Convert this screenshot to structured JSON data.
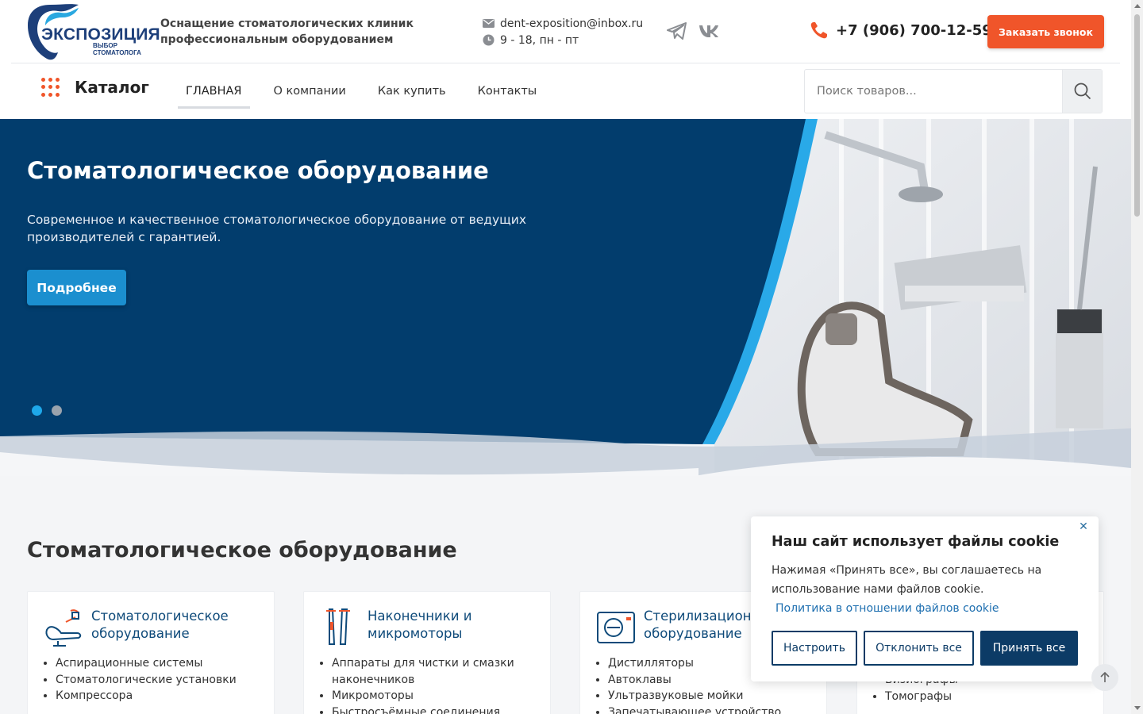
{
  "header": {
    "logo_text": "ЭКСПОЗИЦИЯ",
    "logo_sub": "ВЫБОР СТОМАТОЛОГА",
    "tagline": "Оснащение стоматологических клиник профессиональным оборудованием",
    "email": "dent-exposition@inbox.ru",
    "hours": "9 - 18, пн - пт",
    "phone": "+7 (906) 700-12-59",
    "callback_label": "Заказать звонок",
    "brand_color": "#1d3f7a",
    "accent_color": "#f0552a"
  },
  "nav": {
    "catalog_label": "Каталог",
    "items": [
      {
        "label": "ГЛАВНАЯ"
      },
      {
        "label": "О компании"
      },
      {
        "label": "Как купить"
      },
      {
        "label": "Контакты"
      }
    ],
    "search_placeholder": "Поиск товаров..."
  },
  "hero": {
    "title": "Стоматологическое оборудование",
    "text": "Современное и качественное стоматологическое оборудование от ведущих производителей с гарантией.",
    "button_label": "Подробнее",
    "slides_total": 2,
    "active_slide": 1,
    "bg_color": "#023d6d"
  },
  "section": {
    "title": "Стоматологическое оборудование",
    "cards": [
      {
        "title": "Стоматологическое оборудование",
        "icon": "dental-chair-icon",
        "items": [
          "Аспирационные системы",
          "Стоматологические установки",
          "Компрессора"
        ]
      },
      {
        "title": "Наконечники и микромоторы",
        "icon": "handpiece-icon",
        "items": [
          "Аппараты для чистки и смазки наконечников",
          "Микромоторы",
          "Быстросъёмные соединения"
        ]
      },
      {
        "title": "Стерилизационное оборудование",
        "icon": "sterilizer-icon",
        "items": [
          "Дистилляторы",
          "Автоклавы",
          "Ультразвуковые мойки",
          "Запечатывающее устройство"
        ]
      },
      {
        "title": "",
        "icon": "xray-icon",
        "items": [
          "Визиографы",
          "Томографы"
        ]
      }
    ]
  },
  "cookie": {
    "title": "Наш сайт использует файлы cookie",
    "text": "Нажимая «Принять все», вы соглашаетесь на использование нами файлов cookie.",
    "link": "Политика в отношении файлов cookie",
    "settings_label": "Настроить",
    "reject_label": "Отклонить все",
    "accept_label": "Принять все",
    "close": "✕"
  }
}
